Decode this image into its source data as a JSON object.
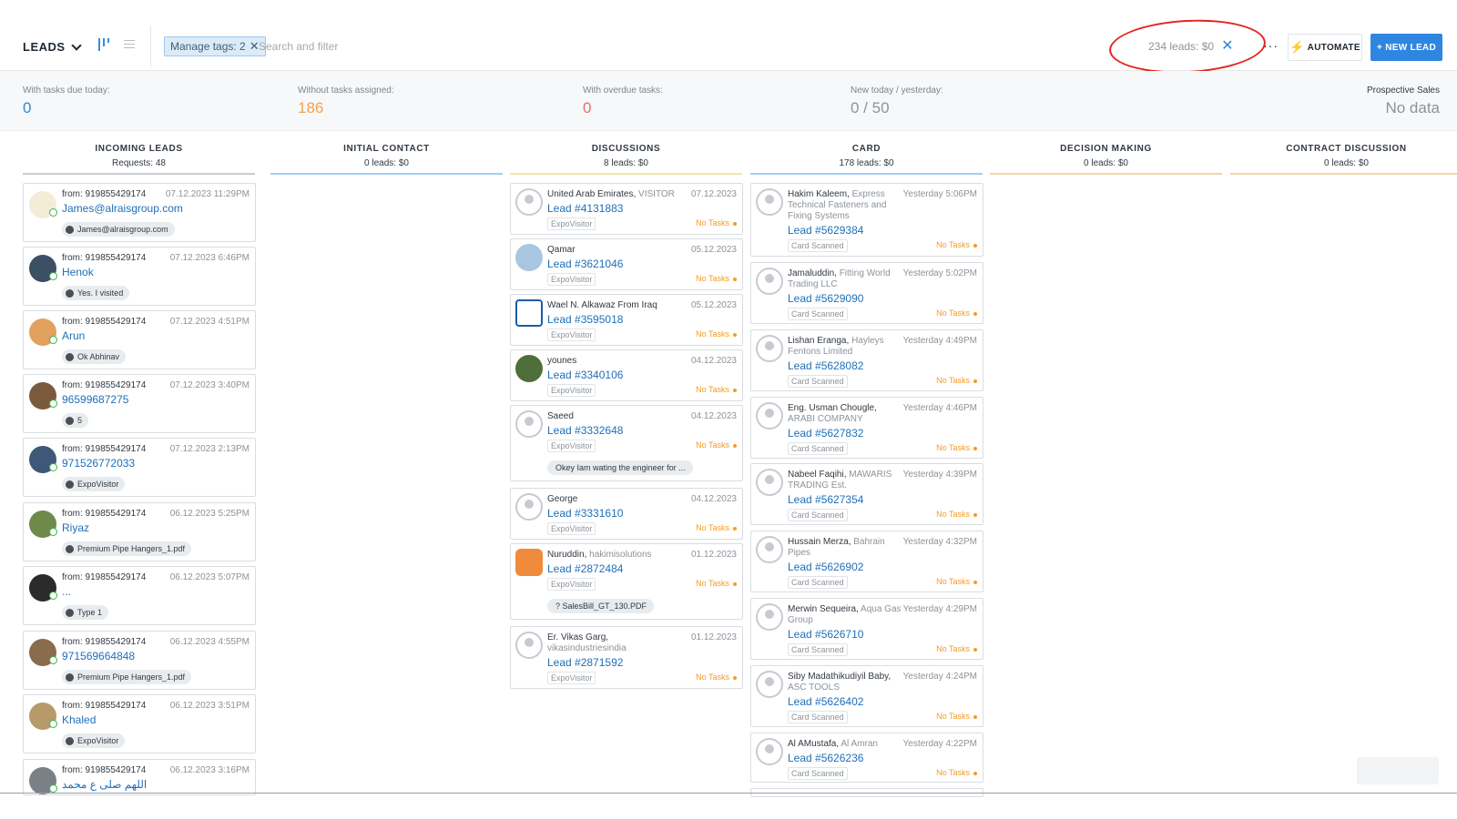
{
  "header": {
    "title": "LEADS",
    "tag_chip": "Manage tags: 2",
    "search_placeholder": "Search and filter",
    "summary": "234 leads: $0",
    "more": "···",
    "automate_label": "AUTOMATE",
    "new_lead_label": "+ NEW LEAD"
  },
  "stats": [
    {
      "label": "With tasks due today:",
      "value": "0",
      "color": "#2f86d6"
    },
    {
      "label": "Without tasks assigned:",
      "value": "186",
      "color": "#f0a44a"
    },
    {
      "label": "With overdue tasks:",
      "value": "0",
      "color": "#ec6f5e"
    },
    {
      "label": "New today / yesterday:",
      "value": "0 / 50",
      "color": "#8d9399"
    },
    {
      "label": "Prospective Sales",
      "value": "No data",
      "color": "#8d9399"
    }
  ],
  "columns": [
    {
      "title": "INCOMING LEADS",
      "sub": "Requests: 48",
      "color": "#c9cdd1"
    },
    {
      "title": "INITIAL CONTACT",
      "sub": "0 leads: $0",
      "color": "#a6cdef"
    },
    {
      "title": "DISCUSSIONS",
      "sub": "8 leads: $0",
      "color": "#f3e5a6"
    },
    {
      "title": "CARD",
      "sub": "178 leads: $0",
      "color": "#a6cdef"
    },
    {
      "title": "DECISION MAKING",
      "sub": "0 leads: $0",
      "color": "#f5d3a6"
    },
    {
      "title": "CONTRACT DISCUSSION",
      "sub": "0 leads: $0",
      "color": "#f5d3a6"
    }
  ],
  "incoming": [
    {
      "from": "from: 919855429174",
      "date": "07.12.2023 11:29PM",
      "name": "James@alraisgroup.com",
      "msg": "James@alraisgroup.com"
    },
    {
      "from": "from: 919855429174",
      "date": "07.12.2023 6:46PM",
      "name": "Henok",
      "msg": "Yes. I visited"
    },
    {
      "from": "from: 919855429174",
      "date": "07.12.2023 4:51PM",
      "name": "Arun",
      "msg": "Ok Abhinav"
    },
    {
      "from": "from: 919855429174",
      "date": "07.12.2023 3:40PM",
      "name": "96599687275",
      "msg": "5"
    },
    {
      "from": "from: 919855429174",
      "date": "07.12.2023 2:13PM",
      "name": "971526772033",
      "msg": "ExpoVisitor"
    },
    {
      "from": "from: 919855429174",
      "date": "06.12.2023 5:25PM",
      "name": "Riyaz",
      "msg": "Premium Pipe Hangers_1.pdf"
    },
    {
      "from": "from: 919855429174",
      "date": "06.12.2023 5:07PM",
      "name": "...",
      "msg": "Type 1"
    },
    {
      "from": "from: 919855429174",
      "date": "06.12.2023 4:55PM",
      "name": "971569664848",
      "msg": "Premium Pipe Hangers_1.pdf"
    },
    {
      "from": "from: 919855429174",
      "date": "06.12.2023 3:51PM",
      "name": "Khaled",
      "msg": "ExpoVisitor"
    },
    {
      "from": "from: 919855429174",
      "date": "06.12.2023 3:16PM",
      "name": "اللهم صلى ع محمد",
      "msg": ""
    }
  ],
  "discussions": [
    {
      "name": "United Arab Emirates,",
      "company": "VISITOR",
      "date": "07.12.2023",
      "lead": "Lead #4131883",
      "tag": "ExpoVisitor",
      "tasks": "No Tasks",
      "msg": ""
    },
    {
      "name": "Qamar",
      "company": "",
      "date": "05.12.2023",
      "lead": "Lead #3621046",
      "tag": "ExpoVisitor",
      "tasks": "No Tasks",
      "msg": ""
    },
    {
      "name": "Wael N. Alkawaz From Iraq",
      "company": "",
      "date": "05.12.2023",
      "lead": "Lead #3595018",
      "tag": "ExpoVisitor",
      "tasks": "No Tasks",
      "msg": ""
    },
    {
      "name": "younes",
      "company": "",
      "date": "04.12.2023",
      "lead": "Lead #3340106",
      "tag": "ExpoVisitor",
      "tasks": "No Tasks",
      "msg": ""
    },
    {
      "name": "Saeed",
      "company": "",
      "date": "04.12.2023",
      "lead": "Lead #3332648",
      "tag": "ExpoVisitor",
      "tasks": "No Tasks",
      "msg": "Okey Iam wating the engineer for ..."
    },
    {
      "name": "George",
      "company": "",
      "date": "04.12.2023",
      "lead": "Lead #3331610",
      "tag": "ExpoVisitor",
      "tasks": "No Tasks",
      "msg": ""
    },
    {
      "name": "Nuruddin,",
      "company": "hakimisolutions",
      "date": "01.12.2023",
      "lead": "Lead #2872484",
      "tag": "ExpoVisitor",
      "tasks": "No Tasks",
      "msg": "? SalesBill_GT_130.PDF"
    },
    {
      "name": "Er. Vikas Garg,",
      "company": "vikasindustriesindia",
      "date": "01.12.2023",
      "lead": "Lead #2871592",
      "tag": "ExpoVisitor",
      "tasks": "No Tasks",
      "msg": ""
    }
  ],
  "card_col": [
    {
      "name": "Hakim Kaleem,",
      "company": "Express Technical Fasteners and Fixing Systems",
      "date": "Yesterday 5:06PM",
      "lead": "Lead #5629384",
      "tag": "Card Scanned",
      "tasks": "No Tasks"
    },
    {
      "name": "Jamaluddin,",
      "company": "Fitting World Trading LLC",
      "date": "Yesterday 5:02PM",
      "lead": "Lead #5629090",
      "tag": "Card Scanned",
      "tasks": "No Tasks"
    },
    {
      "name": "Lishan Eranga,",
      "company": "Hayleys Fentons Limited",
      "date": "Yesterday 4:49PM",
      "lead": "Lead #5628082",
      "tag": "Card Scanned",
      "tasks": "No Tasks"
    },
    {
      "name": "Eng. Usman Chougle,",
      "company": "ARABI COMPANY",
      "date": "Yesterday 4:46PM",
      "lead": "Lead #5627832",
      "tag": "Card Scanned",
      "tasks": "No Tasks"
    },
    {
      "name": "Nabeel Faqihi,",
      "company": "MAWARIS TRADING Est.",
      "date": "Yesterday 4:39PM",
      "lead": "Lead #5627354",
      "tag": "Card Scanned",
      "tasks": "No Tasks"
    },
    {
      "name": "Hussain Merza,",
      "company": "Bahrain Pipes",
      "date": "Yesterday 4:32PM",
      "lead": "Lead #5626902",
      "tag": "Card Scanned",
      "tasks": "No Tasks"
    },
    {
      "name": "Merwin Sequeira,",
      "company": "Aqua Gas Group",
      "date": "Yesterday 4:29PM",
      "lead": "Lead #5626710",
      "tag": "Card Scanned",
      "tasks": "No Tasks"
    },
    {
      "name": "Siby Madathikudiyil Baby,",
      "company": "ASC TOOLS",
      "date": "Yesterday 4:24PM",
      "lead": "Lead #5626402",
      "tag": "Card Scanned",
      "tasks": "No Tasks"
    },
    {
      "name": "Al AMustafa,",
      "company": "Al Amran",
      "date": "Yesterday 4:22PM",
      "lead": "Lead #5626236",
      "tag": "Card Scanned",
      "tasks": "No Tasks"
    }
  ]
}
